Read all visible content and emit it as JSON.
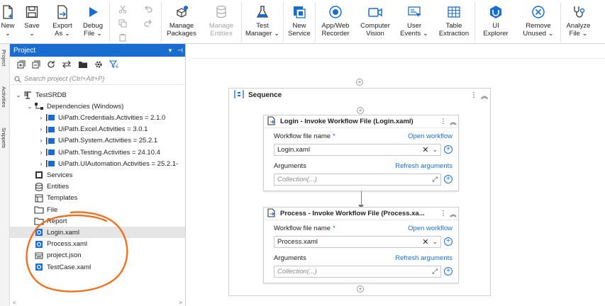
{
  "ribbon": {
    "buttons": [
      {
        "id": "new",
        "icon": "new-file-icon",
        "l1": "New",
        "l2": "⌄"
      },
      {
        "id": "save",
        "icon": "save-icon",
        "l1": "Save",
        "l2": "⌄"
      },
      {
        "id": "export",
        "icon": "export-icon",
        "l1": "Export",
        "l2": "As ⌄"
      },
      {
        "id": "debug",
        "icon": "play-icon",
        "l1": "Debug",
        "l2": "File ⌄"
      }
    ],
    "buttons2": [
      {
        "id": "manage-packages",
        "icon": "packages-icon",
        "l1": "Manage",
        "l2": "Packages",
        "disabled": false
      },
      {
        "id": "manage-entities",
        "icon": "database-icon",
        "l1": "Manage",
        "l2": "Entities",
        "disabled": true
      },
      {
        "id": "test-manager",
        "icon": "flask-icon",
        "l1": "Test",
        "l2": "Manager ⌄",
        "disabled": false
      },
      {
        "id": "new-service",
        "icon": "service-icon",
        "l1": "New",
        "l2": "Service",
        "disabled": false
      },
      {
        "id": "app-web-recorder",
        "icon": "record-icon",
        "l1": "App/Web",
        "l2": "Recorder",
        "disabled": false
      },
      {
        "id": "computer-vision",
        "icon": "camera-icon",
        "l1": "Computer",
        "l2": "Vision",
        "disabled": false
      },
      {
        "id": "user-events",
        "icon": "user-events-icon",
        "l1": "User",
        "l2": "Events ⌄",
        "disabled": false
      },
      {
        "id": "table-extraction",
        "icon": "table-icon",
        "l1": "Table",
        "l2": "Extraction",
        "disabled": false
      },
      {
        "id": "ui-explorer",
        "icon": "ui-explorer-icon",
        "l1": "UI",
        "l2": "Explorer",
        "disabled": false
      },
      {
        "id": "remove-unused",
        "icon": "remove-icon",
        "l1": "Remove",
        "l2": "Unused ⌄",
        "disabled": false
      },
      {
        "id": "analyze-file",
        "icon": "analyze-icon",
        "l1": "Analyze",
        "l2": "File ⌄",
        "disabled": false
      }
    ]
  },
  "rail": {
    "project": "Project",
    "activities": "Activities",
    "snippets": "Snippets"
  },
  "panel": {
    "title": "Project",
    "search_placeholder": "Search project (Ctrl+Alt+P)",
    "scroll_left": "<",
    "scroll_right": ">",
    "tree": [
      {
        "label": "TestSRDB",
        "level": 0,
        "chev": "⌄",
        "icon": "project-icon"
      },
      {
        "label": "Dependencies (Windows)",
        "level": 1,
        "chev": "⌄",
        "icon": "dependencies-icon"
      },
      {
        "label": "UiPath.Credentials.Activities = 2.1.0",
        "level": 2,
        "chev": "›",
        "icon": "package-icon"
      },
      {
        "label": "UiPath.Excel.Activities = 3.0.1",
        "level": 2,
        "chev": "›",
        "icon": "package-icon"
      },
      {
        "label": "UiPath.System.Activities = 25.2.1",
        "level": 2,
        "chev": "›",
        "icon": "package-icon"
      },
      {
        "label": "UiPath.Testing.Activities = 24.10.4",
        "level": 2,
        "chev": "›",
        "icon": "package-icon"
      },
      {
        "label": "UiPath.UIAutomation.Activities = 25.2.1-",
        "level": 2,
        "chev": "›",
        "icon": "package-icon"
      },
      {
        "label": "Services",
        "level": 1,
        "chev": "",
        "icon": "services-icon"
      },
      {
        "label": "Entities",
        "level": 1,
        "chev": "",
        "icon": "entities-icon"
      },
      {
        "label": "Templates",
        "level": 1,
        "chev": "",
        "icon": "templates-icon"
      },
      {
        "label": "File",
        "level": 1,
        "chev": "",
        "icon": "folder-icon"
      },
      {
        "label": "Report",
        "level": 1,
        "chev": "",
        "icon": "folder-icon"
      },
      {
        "label": "Login.xaml",
        "level": 1,
        "chev": "",
        "icon": "xaml-icon",
        "selected": true
      },
      {
        "label": "Process.xaml",
        "level": 1,
        "chev": "",
        "icon": "xaml-icon"
      },
      {
        "label": "project.json",
        "level": 1,
        "chev": "",
        "icon": "json-icon"
      },
      {
        "label": "TestCase.xaml",
        "level": 1,
        "chev": "",
        "icon": "xaml-icon"
      }
    ]
  },
  "sequence": {
    "title": "Sequence",
    "cards": [
      {
        "title": "Login - Invoke Workflow File (Login.xaml)",
        "file_label": "Workflow file name",
        "required": "*",
        "open_link": "Open workflow",
        "file_value": "Login.xaml",
        "args_label": "Arguments",
        "refresh_link": "Refresh arguments",
        "args_placeholder": "Collection(...)"
      },
      {
        "title": "Process - Invoke Workflow File (Process.xa...",
        "file_label": "Workflow file name",
        "required": "*",
        "open_link": "Open workflow",
        "file_value": "Process.xaml",
        "args_label": "Arguments",
        "refresh_link": "Refresh arguments",
        "args_placeholder": "Collection(...)"
      }
    ]
  },
  "colors": {
    "accent": "#1a6dd0",
    "annotation": "#f07020",
    "panel_header": "#1a6dd0"
  }
}
